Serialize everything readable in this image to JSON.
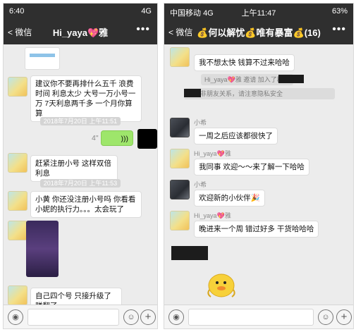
{
  "left": {
    "status": {
      "time": "6:40",
      "carrier": "",
      "signal": "4G"
    },
    "nav": {
      "back": "微信",
      "title": "Hi_yaya💖雅",
      "more": "•••"
    },
    "messages": [
      {
        "text": "建议你不要再排什么五千 浪费时间 利息太少 大号一万小号一万 7天利息两千多 一个月你算算"
      },
      {
        "text": "赶紧注册小号 这样双倍利息"
      },
      {
        "text": "小黄 你还没注册小号吗 你看看小妮的执行力。。。太会玩了"
      },
      {
        "text": "自己四个号 只接升级了 赚翻了"
      }
    ],
    "timestamps": [
      "2018年7月20日 上午11:51",
      "2018年7月20日 上午11:53"
    ],
    "voice_duration": "4\"",
    "input": {
      "voice": "◉",
      "emoji": "☺",
      "plus": "+"
    }
  },
  "right": {
    "status": {
      "carrier": "中国移动",
      "signal": "4G",
      "time": "上午11:47",
      "battery": "63%"
    },
    "nav": {
      "back": "微信",
      "title": "💰何以解忧💰唯有暴富💰(16)",
      "more": "•••"
    },
    "messages": [
      {
        "nick": "Hi_yaya💖雅",
        "text": "我不想太快 钱算不过来哈哈"
      },
      {
        "nick": "小希",
        "text": "一周之后应该都很快了"
      },
      {
        "nick": "Hi_yaya💖雅",
        "text": "我同事 欢迎～～来了解一下哈哈"
      },
      {
        "nick": "小希",
        "text": "欢迎新的小伙伴🎉"
      },
      {
        "nick": "Hi_yaya💖雅",
        "text": "晚进来一个周 错过好多 干货哈哈哈"
      }
    ],
    "system": {
      "invite": "Hi_yaya💖雅 邀请 加入了群聊",
      "notice": "群聊非朋友关系，请注意隐私安全"
    },
    "input": {
      "voice": "◉",
      "emoji": "☺",
      "plus": "+"
    }
  },
  "colors": {
    "header": "#2f2f2f",
    "chat_bg": "#ececec",
    "bubble_green": "#9ee66b"
  }
}
